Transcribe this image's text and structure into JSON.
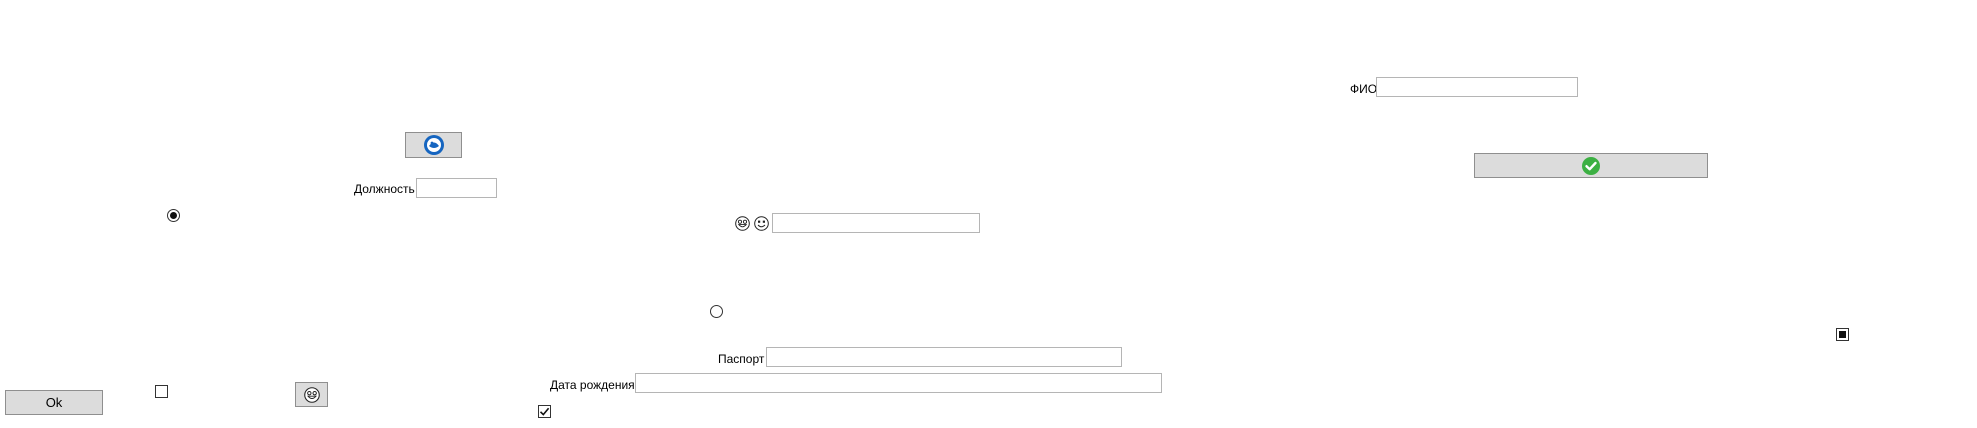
{
  "labels": {
    "fio": "ФИО",
    "position": "Должность",
    "passport": "Паспорт",
    "birth_date": "Дата рождения"
  },
  "fields": {
    "fio": {
      "value": "",
      "placeholder": ""
    },
    "position": {
      "value": "",
      "placeholder": ""
    },
    "middle": {
      "value": "",
      "placeholder": ""
    },
    "passport": {
      "value": "",
      "placeholder": ""
    },
    "birth_date": {
      "value": "",
      "placeholder": ""
    }
  },
  "buttons": {
    "ok_label": "Ok"
  },
  "icons": {
    "top_button_icon": "blue-circle-icon",
    "confirm_icon": "green-check-icon",
    "smiley_icon": "smiley-icon"
  },
  "states": {
    "radio_left_selected": true,
    "radio_middle_selected": false,
    "checkbox_bottom_left_checked": false,
    "checkbox_bottom_middle_checked": true,
    "checkbox_right_indeterminate": true
  },
  "colors": {
    "button_bg": "#dcdcdc",
    "accent_blue": "#1565c0",
    "accent_green": "#3cb043"
  }
}
